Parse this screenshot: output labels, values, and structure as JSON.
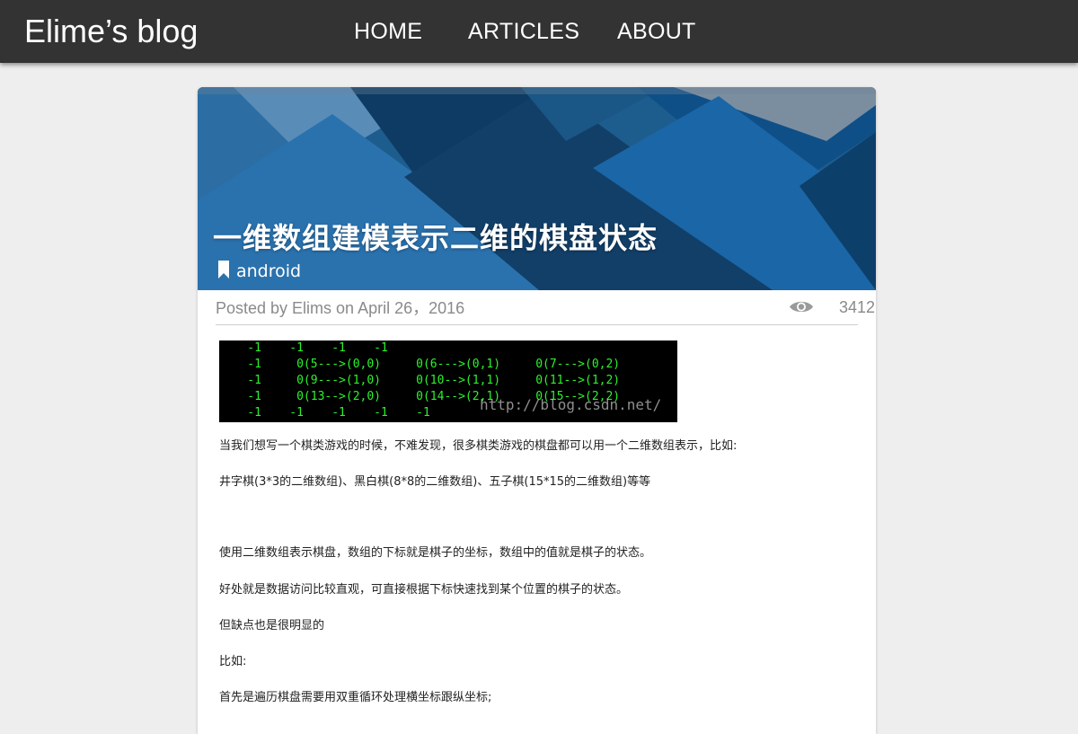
{
  "header": {
    "brand": "Elime’s blog",
    "nav": [
      "HOME",
      "ARTICLES",
      "ABOUT"
    ]
  },
  "post": {
    "title": "一维数组建模表示二维的棋盘状态",
    "tag": "android",
    "meta": "Posted by Elims on April 26，2016",
    "views": "3412",
    "terminal": {
      "lines": [
        "    -1    -1    -1    -1",
        "    -1     0(5--->(0,0)     0(6--->(0,1)     0(7--->(0,2)",
        "    -1     0(9--->(1,0)     0(10-->(1,1)     0(11-->(1,2)",
        "    -1     0(13-->(2,0)     0(14-->(2,1)     0(15-->(2,2)",
        "    -1    -1    -1    -1    -1"
      ],
      "watermark": "http://blog.csdn.net/"
    },
    "paragraphs": [
      "当我们想写一个棋类游戏的时候，不难发现，很多棋类游戏的棋盘都可以用一个二维数组表示，比如:",
      "井字棋(3*3的二维数组)、黑白棋(8*8的二维数组)、五子棋(15*15的二维数组)等等",
      "使用二维数组表示棋盘，数组的下标就是棋子的坐标，数组中的值就是棋子的状态。",
      "好处就是数据访问比较直观，可直接根据下标快速找到某个位置的棋子的状态。",
      "但缺点也是很明显的",
      "比如:",
      "首先是遍历棋盘需要用双重循环处理横坐标跟纵坐标;"
    ]
  },
  "icons": {
    "tag": "bookmark-icon",
    "views": "eye-icon"
  },
  "colors": {
    "topbar": "#333333",
    "page_background": "#eeeeee",
    "banner_blue": "#1d5d8e",
    "terminal_text": "#2df22d",
    "meta_text": "#8a8a8a"
  }
}
